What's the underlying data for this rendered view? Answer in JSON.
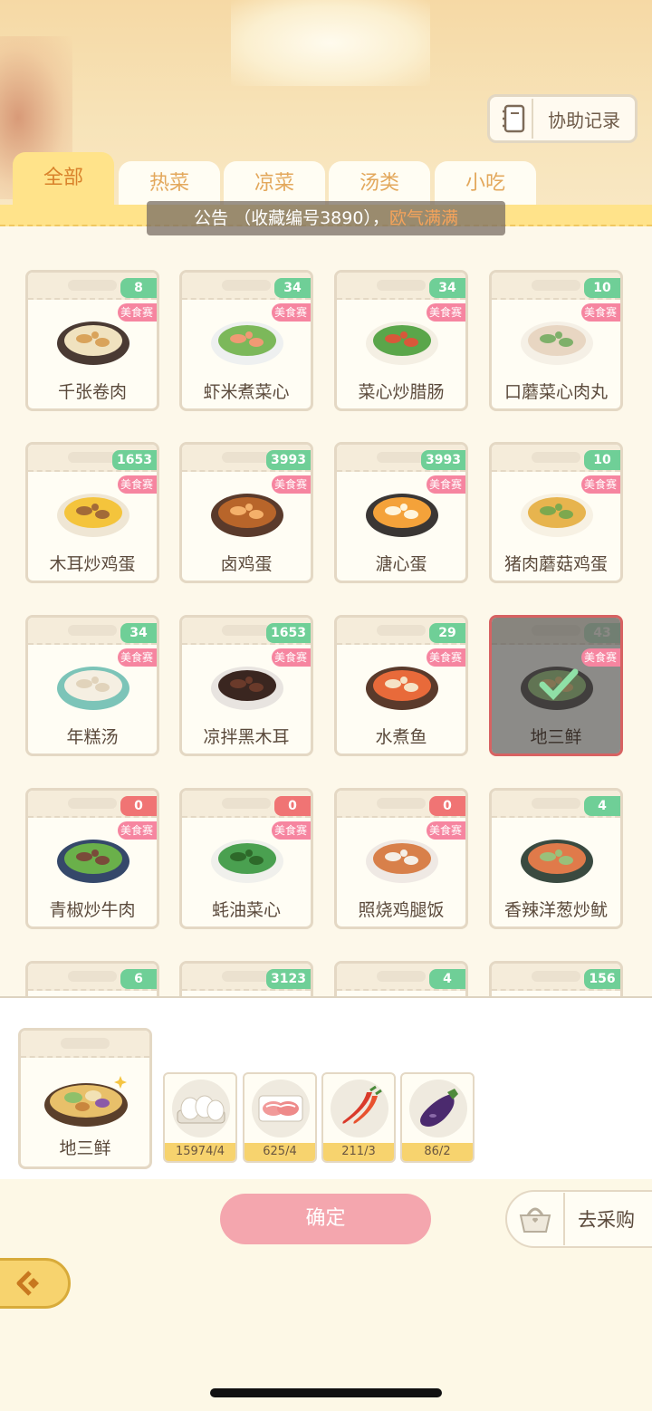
{
  "header": {
    "assist_label": "协助记录",
    "assist_icon": "notebook-icon"
  },
  "tabs": [
    {
      "label": "全部",
      "active": true
    },
    {
      "label": "热菜",
      "active": false
    },
    {
      "label": "凉菜",
      "active": false
    },
    {
      "label": "汤类",
      "active": false
    },
    {
      "label": "小吃",
      "active": false
    }
  ],
  "notice": {
    "text": "公告 （收藏编号3890），",
    "highlight": "欧气满满"
  },
  "badge_label": "美食赛",
  "dishes": [
    {
      "name": "千张卷肉",
      "count": "8",
      "badge": true
    },
    {
      "name": "虾米煮菜心",
      "count": "34",
      "badge": true
    },
    {
      "name": "菜心炒腊肠",
      "count": "34",
      "badge": true
    },
    {
      "name": "口蘑菜心肉丸",
      "count": "10",
      "badge": true
    },
    {
      "name": "木耳炒鸡蛋",
      "count": "1653",
      "badge": true
    },
    {
      "name": "卤鸡蛋",
      "count": "3993",
      "badge": true
    },
    {
      "name": "溏心蛋",
      "count": "3993",
      "badge": true
    },
    {
      "name": "猪肉蘑菇鸡蛋",
      "count": "10",
      "badge": true
    },
    {
      "name": "年糕汤",
      "count": "34",
      "badge": true
    },
    {
      "name": "凉拌黑木耳",
      "count": "1653",
      "badge": true
    },
    {
      "name": "水煮鱼",
      "count": "29",
      "badge": true
    },
    {
      "name": "地三鲜",
      "count": "43",
      "badge": true,
      "selected": true
    },
    {
      "name": "青椒炒牛肉",
      "count": "0",
      "badge": true
    },
    {
      "name": "蚝油菜心",
      "count": "0",
      "badge": true
    },
    {
      "name": "照烧鸡腿饭",
      "count": "0",
      "badge": true
    },
    {
      "name": "香辣洋葱炒鱿",
      "count": "4",
      "badge": false
    },
    {
      "name": "",
      "count": "6",
      "badge": false
    },
    {
      "name": "",
      "count": "3123",
      "badge": false
    },
    {
      "name": "",
      "count": "4",
      "badge": false
    },
    {
      "name": "",
      "count": "156",
      "badge": false
    }
  ],
  "selected": {
    "name": "地三鲜",
    "ingredients": [
      {
        "icon": "eggs-icon",
        "qty": "15974/4"
      },
      {
        "icon": "meat-slices-icon",
        "qty": "625/4"
      },
      {
        "icon": "chili-pepper-icon",
        "qty": "211/3"
      },
      {
        "icon": "eggplant-icon",
        "qty": "86/2"
      }
    ]
  },
  "actions": {
    "confirm_label": "确定",
    "buy_label": "去采购",
    "buy_icon": "basket-icon",
    "back_icon": "back-arrow-icon"
  },
  "colors": {
    "tab_active": "#ffe38a",
    "count_green": "#6fcf97",
    "count_red": "#f07474",
    "badge_pink": "#f685a0",
    "confirm_pink": "#f4a6ae",
    "notice_highlight": "#f5a35b"
  }
}
